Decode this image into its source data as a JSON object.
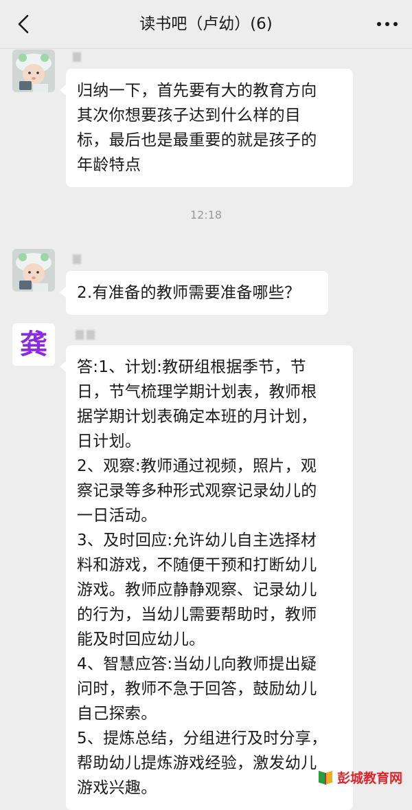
{
  "header": {
    "title": "读书吧（卢幼）(6)",
    "back_icon": "chevron-left-icon",
    "more_icon": "more-dots-icon"
  },
  "messages": [
    {
      "text": "归纳一下，首先要有大的教育方向\n其次你想要孩子达到什么样的目\n标，最后也是最重要的就是孩子的\n年龄特点"
    },
    {
      "text": "2.有准备的教师需要准备哪些？"
    },
    {
      "text": "答:1、计划:教研组根据季节，节\n日，节气梳理学期计划表，教师根\n据学期计划表确定本班的月计划，\n日计划。\n2、观察:教师通过视频，照片，观\n察记录等多种形式观察记录幼儿的\n一日活动。\n3、及时回应:允许幼儿自主选择材\n料和游戏，不随便干预和打断幼儿\n游戏。教师应静静观察、记录幼儿\n的行为，当幼儿需要帮助时，教师\n能及时回应幼儿。\n4、智慧应答:当幼儿向教师提出疑\n问时，教师不急于回答，鼓励幼儿\n自己探索。\n5、提炼总结，分组进行及时分享，\n帮助幼儿提炼游戏经验，激发幼儿\n游戏兴趣。"
    }
  ],
  "timestamp": "12:18",
  "avatar_text": "龚",
  "watermark": {
    "text": "彭城教育网",
    "icon": "book-logo-icon"
  },
  "colors": {
    "background": "#ededed",
    "bubble": "#ffffff",
    "text": "#1a1a1a",
    "timestamp": "#9a9a9a",
    "avatar_text": "#8a2be2",
    "watermark": "#d8262c"
  }
}
